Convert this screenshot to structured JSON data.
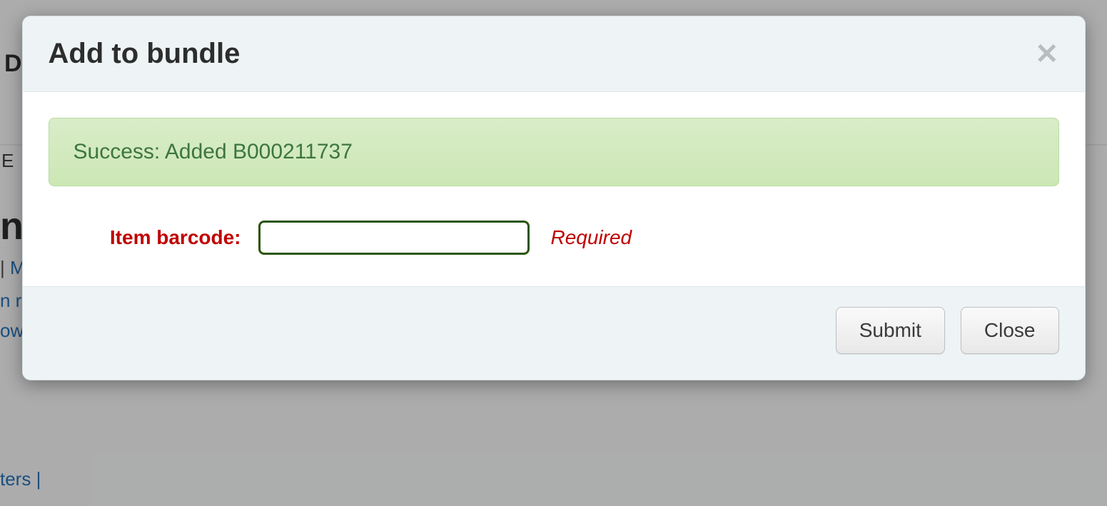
{
  "background": {
    "letter_top": "D",
    "edit_fragment": "E",
    "title_fragment": "n",
    "link1_sep": " | ",
    "link1_char": "M",
    "line2": "n r",
    "line3": "ow",
    "bottom_fragment": "ters | "
  },
  "modal": {
    "title": "Add to bundle",
    "alert": "Success: Added B000211737",
    "form": {
      "label": "Item barcode:",
      "value": "",
      "required_hint": "Required"
    },
    "buttons": {
      "submit": "Submit",
      "close": "Close"
    }
  }
}
